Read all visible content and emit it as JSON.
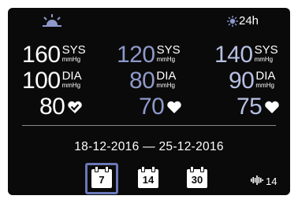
{
  "periods": {
    "day": {
      "icon": "sunrise-icon"
    },
    "night": {
      "icon": "moon-icon"
    },
    "total": {
      "icon": "sun-moon-icon",
      "label": "24h"
    }
  },
  "readings": {
    "day": {
      "sys": "160",
      "dia": "100",
      "pulse": "80"
    },
    "night": {
      "sys": "120",
      "dia": "80",
      "pulse": "70"
    },
    "total": {
      "sys": "140",
      "dia": "90",
      "pulse": "75"
    }
  },
  "labels": {
    "sys": "SYS",
    "dia": "DIA",
    "unit": "mmHg"
  },
  "date_range": "18-12-2016 — 25-12-2016",
  "period_buttons": [
    {
      "label": "7",
      "selected": true
    },
    {
      "label": "14",
      "selected": false
    },
    {
      "label": "30",
      "selected": false
    }
  ],
  "measurement_count": "14",
  "colors": {
    "background": "#0a0a0a",
    "day_text": "#ffffff",
    "night_text": "#8e99c9",
    "selected_border": "#6b77b8"
  }
}
